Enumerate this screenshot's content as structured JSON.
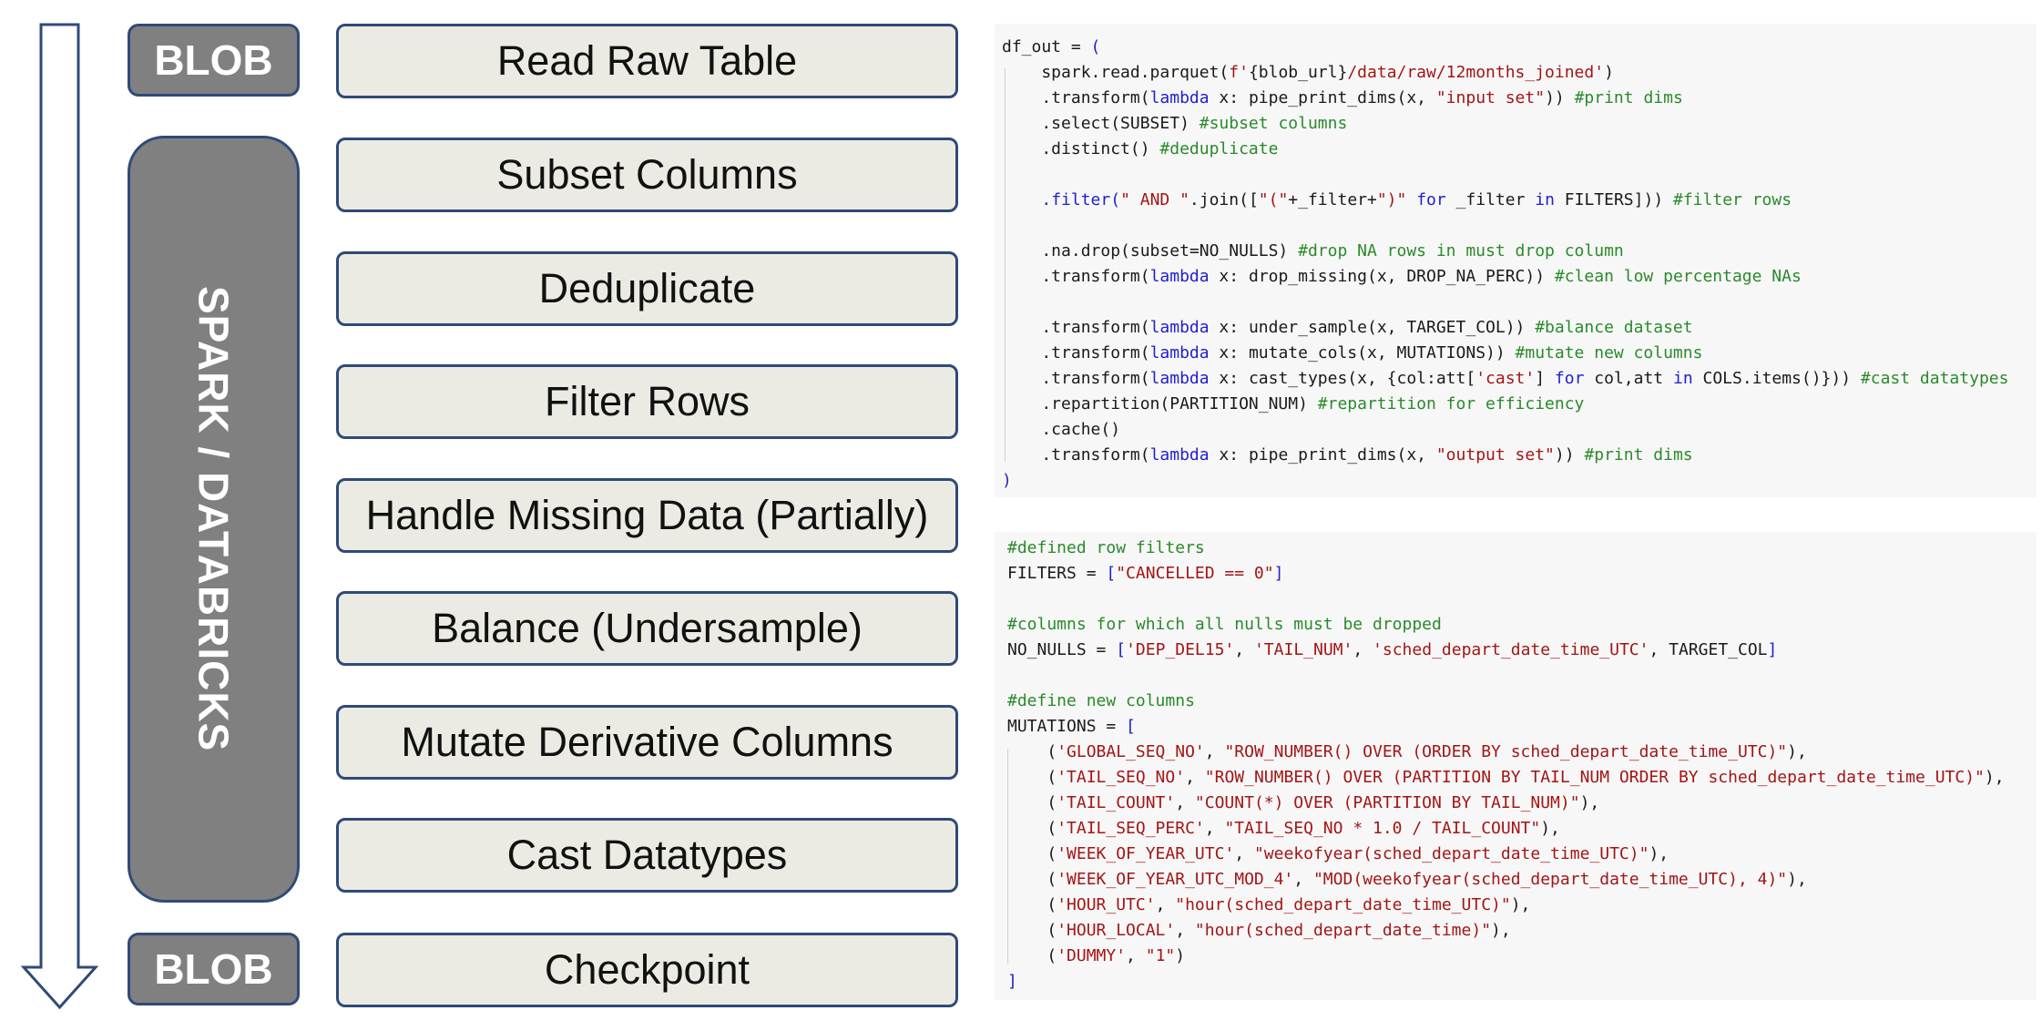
{
  "pipeline": {
    "blob_top": "BLOB",
    "blob_bottom": "BLOB",
    "group_label": "SPARK / DATABRICKS",
    "steps": [
      "Read Raw Table",
      "Subset Columns",
      "Deduplicate",
      "Filter Rows",
      "Handle Missing Data (Partially)",
      "Balance (Undersample)",
      "Mutate Derivative Columns",
      "Cast Datatypes",
      "Checkpoint"
    ]
  },
  "code_block_1": [
    [
      [
        "df_out = ",
        "p"
      ],
      [
        "(",
        "pn"
      ]
    ],
    [
      [
        "    spark.read.parquet(",
        "p"
      ],
      [
        "f'",
        "str"
      ],
      [
        "{blob_url}",
        "p"
      ],
      [
        "/data/raw/12months_joined'",
        "str"
      ],
      [
        ")",
        "p"
      ]
    ],
    [
      [
        "    .transform(",
        "p"
      ],
      [
        "lambda",
        "kw"
      ],
      [
        " x: pipe_print_dims(x, ",
        "p"
      ],
      [
        "\"input set\"",
        "str"
      ],
      [
        "))",
        "p"
      ],
      [
        " #print dims",
        "cm"
      ]
    ],
    [
      [
        "    .select(SUBSET)",
        "p"
      ],
      [
        " #subset columns",
        "cm"
      ]
    ],
    [
      [
        "    .distinct()",
        "p"
      ],
      [
        " #deduplicate",
        "cm"
      ]
    ],
    [
      [
        "",
        "p"
      ]
    ],
    [
      [
        "    ",
        "p"
      ],
      [
        ".filter(",
        "kw"
      ],
      [
        "\" AND \"",
        "str"
      ],
      [
        ".join([",
        "p"
      ],
      [
        "\"(\"",
        "str"
      ],
      [
        "+_filter+",
        "p"
      ],
      [
        "\")\"",
        "str"
      ],
      [
        " ",
        "p"
      ],
      [
        "for",
        "kw"
      ],
      [
        " _filter ",
        "p"
      ],
      [
        "in",
        "kw"
      ],
      [
        " FILTERS]))",
        "p"
      ],
      [
        " #filter rows",
        "cm"
      ]
    ],
    [
      [
        "",
        "p"
      ]
    ],
    [
      [
        "    .na.drop(subset=NO_NULLS)",
        "p"
      ],
      [
        " #drop NA rows in must drop column",
        "cm"
      ]
    ],
    [
      [
        "    .transform(",
        "p"
      ],
      [
        "lambda",
        "kw"
      ],
      [
        " x: drop_missing(x, DROP_NA_PERC))",
        "p"
      ],
      [
        " #clean low percentage NAs",
        "cm"
      ]
    ],
    [
      [
        "",
        "p"
      ]
    ],
    [
      [
        "    .transform(",
        "p"
      ],
      [
        "lambda",
        "kw"
      ],
      [
        " x: under_sample(x, TARGET_COL))",
        "p"
      ],
      [
        " #balance dataset",
        "cm"
      ]
    ],
    [
      [
        "    .transform(",
        "p"
      ],
      [
        "lambda",
        "kw"
      ],
      [
        " x: mutate_cols(x, MUTATIONS))",
        "p"
      ],
      [
        " #mutate new columns",
        "cm"
      ]
    ],
    [
      [
        "    .transform(",
        "p"
      ],
      [
        "lambda",
        "kw"
      ],
      [
        " x: cast_types(x, {col:att[",
        "p"
      ],
      [
        "'cast'",
        "str"
      ],
      [
        "] ",
        "p"
      ],
      [
        "for",
        "kw"
      ],
      [
        " col,att ",
        "p"
      ],
      [
        "in",
        "kw"
      ],
      [
        " COLS.items()}))",
        "p"
      ],
      [
        " #cast datatypes",
        "cm"
      ]
    ],
    [
      [
        "    .repartition(PARTITION_NUM)",
        "p"
      ],
      [
        " #repartition for efficiency",
        "cm"
      ]
    ],
    [
      [
        "    .cache()",
        "p"
      ]
    ],
    [
      [
        "    .transform(",
        "p"
      ],
      [
        "lambda",
        "kw"
      ],
      [
        " x: pipe_print_dims(x, ",
        "p"
      ],
      [
        "\"output set\"",
        "str"
      ],
      [
        "))",
        "p"
      ],
      [
        " #print dims",
        "cm"
      ]
    ],
    [
      [
        ")",
        "pn"
      ]
    ]
  ],
  "code_block_2": [
    [
      [
        "#defined row filters",
        "cm"
      ]
    ],
    [
      [
        "FILTERS = ",
        "p"
      ],
      [
        "[",
        "pn"
      ],
      [
        "\"CANCELLED == 0\"",
        "str"
      ],
      [
        "]",
        "pn"
      ]
    ],
    [
      [
        "",
        "p"
      ]
    ],
    [
      [
        "#columns for which all nulls must be dropped",
        "cm"
      ]
    ],
    [
      [
        "NO_NULLS = ",
        "p"
      ],
      [
        "[",
        "pn"
      ],
      [
        "'DEP_DEL15'",
        "str"
      ],
      [
        ", ",
        "p"
      ],
      [
        "'TAIL_NUM'",
        "str"
      ],
      [
        ", ",
        "p"
      ],
      [
        "'sched_depart_date_time_UTC'",
        "str"
      ],
      [
        ", TARGET_COL",
        "p"
      ],
      [
        "]",
        "pn"
      ]
    ],
    [
      [
        "",
        "p"
      ]
    ],
    [
      [
        "#define new columns",
        "cm"
      ]
    ],
    [
      [
        "MUTATIONS = ",
        "p"
      ],
      [
        "[",
        "pn"
      ]
    ],
    [
      [
        "    (",
        "p"
      ],
      [
        "'GLOBAL_SEQ_NO'",
        "str"
      ],
      [
        ", ",
        "p"
      ],
      [
        "\"ROW_NUMBER() OVER (ORDER BY sched_depart_date_time_UTC)\"",
        "str"
      ],
      [
        "),",
        "p"
      ]
    ],
    [
      [
        "    (",
        "p"
      ],
      [
        "'TAIL_SEQ_NO'",
        "str"
      ],
      [
        ", ",
        "p"
      ],
      [
        "\"ROW_NUMBER() OVER (PARTITION BY TAIL_NUM ORDER BY sched_depart_date_time_UTC)\"",
        "str"
      ],
      [
        "),",
        "p"
      ]
    ],
    [
      [
        "    (",
        "p"
      ],
      [
        "'TAIL_COUNT'",
        "str"
      ],
      [
        ", ",
        "p"
      ],
      [
        "\"COUNT(*) OVER (PARTITION BY TAIL_NUM)\"",
        "str"
      ],
      [
        "),",
        "p"
      ]
    ],
    [
      [
        "    (",
        "p"
      ],
      [
        "'TAIL_SEQ_PERC'",
        "str"
      ],
      [
        ", ",
        "p"
      ],
      [
        "\"TAIL_SEQ_NO * 1.0 / TAIL_COUNT\"",
        "str"
      ],
      [
        "),",
        "p"
      ]
    ],
    [
      [
        "    (",
        "p"
      ],
      [
        "'WEEK_OF_YEAR_UTC'",
        "str"
      ],
      [
        ", ",
        "p"
      ],
      [
        "\"weekofyear(sched_depart_date_time_UTC)\"",
        "str"
      ],
      [
        "),",
        "p"
      ]
    ],
    [
      [
        "    (",
        "p"
      ],
      [
        "'WEEK_OF_YEAR_UTC_MOD_4'",
        "str"
      ],
      [
        ", ",
        "p"
      ],
      [
        "\"MOD(weekofyear(sched_depart_date_time_UTC), 4)\"",
        "str"
      ],
      [
        "),",
        "p"
      ]
    ],
    [
      [
        "    (",
        "p"
      ],
      [
        "'HOUR_UTC'",
        "str"
      ],
      [
        ", ",
        "p"
      ],
      [
        "\"hour(sched_depart_date_time_UTC)\"",
        "str"
      ],
      [
        "),",
        "p"
      ]
    ],
    [
      [
        "    (",
        "p"
      ],
      [
        "'HOUR_LOCAL'",
        "str"
      ],
      [
        ", ",
        "p"
      ],
      [
        "\"hour(sched_depart_date_time)\"",
        "str"
      ],
      [
        "),",
        "p"
      ]
    ],
    [
      [
        "    (",
        "p"
      ],
      [
        "'DUMMY'",
        "str"
      ],
      [
        ", ",
        "p"
      ],
      [
        "\"1\"",
        "str"
      ],
      [
        ")",
        "p"
      ]
    ],
    [
      [
        "]",
        "pn"
      ]
    ]
  ]
}
